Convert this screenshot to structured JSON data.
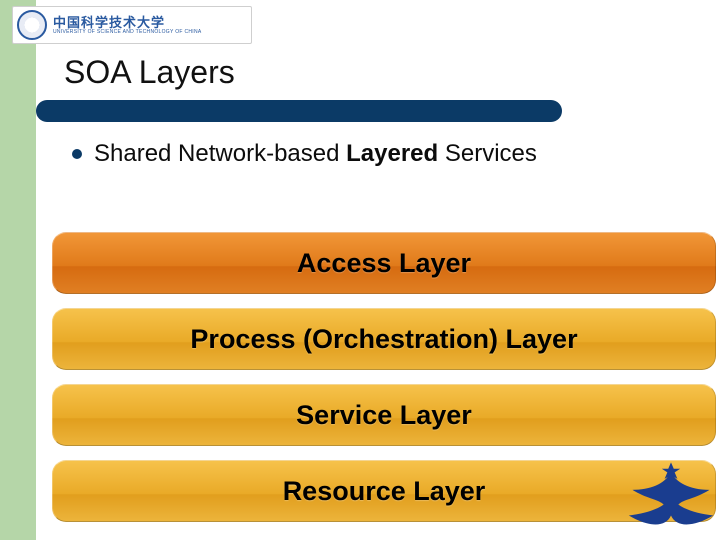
{
  "header": {
    "university_cn": "中国科学技术大学",
    "university_en": "UNIVERSITY OF SCIENCE AND TECHNOLOGY OF CHINA"
  },
  "slide": {
    "title": "SOA Layers",
    "bullet_prefix": "Shared Network-based ",
    "bullet_bold": "Layered",
    "bullet_suffix": " Services"
  },
  "layers": [
    {
      "label": "Access Layer",
      "style": "orange"
    },
    {
      "label": "Process (Orchestration) Layer",
      "style": "amber"
    },
    {
      "label": "Service Layer",
      "style": "amber"
    },
    {
      "label": "Resource Layer",
      "style": "amber"
    }
  ]
}
